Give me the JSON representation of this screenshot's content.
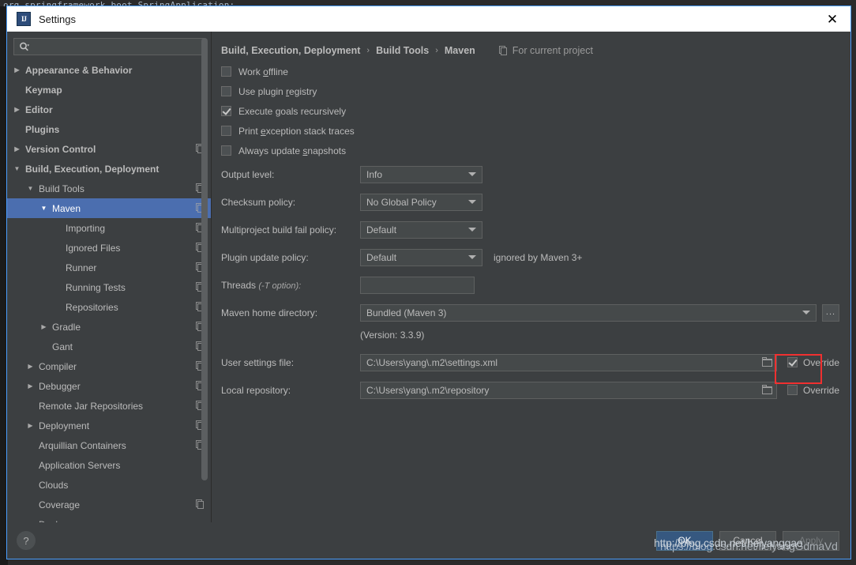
{
  "backdrop": {
    "code_line": "org.springframework.boot.SpringApplication;"
  },
  "window": {
    "title": "Settings",
    "app_icon": "IJ",
    "close_icon": "✕"
  },
  "search": {
    "value": "",
    "placeholder": "",
    "icon": "search-icon"
  },
  "sidebar": {
    "items": [
      {
        "label": "Appearance & Behavior",
        "arrow": "▶",
        "indent": 0,
        "bold": true,
        "project_icon": false,
        "selected": false
      },
      {
        "label": "Keymap",
        "arrow": "",
        "indent": 0,
        "bold": true,
        "project_icon": false,
        "selected": false
      },
      {
        "label": "Editor",
        "arrow": "▶",
        "indent": 0,
        "bold": true,
        "project_icon": false,
        "selected": false
      },
      {
        "label": "Plugins",
        "arrow": "",
        "indent": 0,
        "bold": true,
        "project_icon": false,
        "selected": false
      },
      {
        "label": "Version Control",
        "arrow": "▶",
        "indent": 0,
        "bold": true,
        "project_icon": true,
        "selected": false
      },
      {
        "label": "Build, Execution, Deployment",
        "arrow": "▼",
        "indent": 0,
        "bold": true,
        "project_icon": false,
        "selected": false
      },
      {
        "label": "Build Tools",
        "arrow": "▼",
        "indent": 1,
        "bold": false,
        "project_icon": true,
        "selected": false
      },
      {
        "label": "Maven",
        "arrow": "▼",
        "indent": 2,
        "bold": false,
        "project_icon": true,
        "selected": true
      },
      {
        "label": "Importing",
        "arrow": "",
        "indent": 3,
        "bold": false,
        "project_icon": true,
        "selected": false
      },
      {
        "label": "Ignored Files",
        "arrow": "",
        "indent": 3,
        "bold": false,
        "project_icon": true,
        "selected": false
      },
      {
        "label": "Runner",
        "arrow": "",
        "indent": 3,
        "bold": false,
        "project_icon": true,
        "selected": false
      },
      {
        "label": "Running Tests",
        "arrow": "",
        "indent": 3,
        "bold": false,
        "project_icon": true,
        "selected": false
      },
      {
        "label": "Repositories",
        "arrow": "",
        "indent": 3,
        "bold": false,
        "project_icon": true,
        "selected": false
      },
      {
        "label": "Gradle",
        "arrow": "▶",
        "indent": 2,
        "bold": false,
        "project_icon": true,
        "selected": false
      },
      {
        "label": "Gant",
        "arrow": "",
        "indent": 2,
        "bold": false,
        "project_icon": true,
        "selected": false
      },
      {
        "label": "Compiler",
        "arrow": "▶",
        "indent": 1,
        "bold": false,
        "project_icon": true,
        "selected": false
      },
      {
        "label": "Debugger",
        "arrow": "▶",
        "indent": 1,
        "bold": false,
        "project_icon": true,
        "selected": false
      },
      {
        "label": "Remote Jar Repositories",
        "arrow": "",
        "indent": 1,
        "bold": false,
        "project_icon": true,
        "selected": false
      },
      {
        "label": "Deployment",
        "arrow": "▶",
        "indent": 1,
        "bold": false,
        "project_icon": true,
        "selected": false
      },
      {
        "label": "Arquillian Containers",
        "arrow": "",
        "indent": 1,
        "bold": false,
        "project_icon": true,
        "selected": false
      },
      {
        "label": "Application Servers",
        "arrow": "",
        "indent": 1,
        "bold": false,
        "project_icon": false,
        "selected": false
      },
      {
        "label": "Clouds",
        "arrow": "",
        "indent": 1,
        "bold": false,
        "project_icon": false,
        "selected": false
      },
      {
        "label": "Coverage",
        "arrow": "",
        "indent": 1,
        "bold": false,
        "project_icon": true,
        "selected": false
      },
      {
        "label": "Docker",
        "arrow": "▶",
        "indent": 1,
        "bold": false,
        "project_icon": false,
        "selected": false
      }
    ]
  },
  "breadcrumb": {
    "parts": [
      "Build, Execution, Deployment",
      "Build Tools",
      "Maven"
    ],
    "separator": "›",
    "scope_label": "For current project"
  },
  "maven": {
    "checkboxes": [
      {
        "label_pre": "Work ",
        "mnemonic": "o",
        "label_post": "ffline",
        "checked": false
      },
      {
        "label_pre": "Use plugin ",
        "mnemonic": "r",
        "label_post": "egistry",
        "checked": false
      },
      {
        "label_pre": "Execute ",
        "mnemonic": "g",
        "label_post": "oals recursively",
        "checked": true
      },
      {
        "label_pre": "Print ",
        "mnemonic": "e",
        "label_post": "xception stack traces",
        "checked": false
      },
      {
        "label_pre": "Always update ",
        "mnemonic": "s",
        "label_post": "napshots",
        "checked": false
      }
    ],
    "output_level": {
      "label": "Output level:",
      "value": "Info"
    },
    "checksum_policy": {
      "label": "Checksum policy:",
      "value": "No Global Policy"
    },
    "multiproject_policy": {
      "label": "Multiproject build fail policy:",
      "value": "Default"
    },
    "plugin_update_policy": {
      "label": "Plugin update policy:",
      "value": "Default",
      "note": "ignored by Maven 3+"
    },
    "threads": {
      "label": "Threads",
      "hint": "(-T option):",
      "value": ""
    },
    "home_directory": {
      "label": "Maven home directory:",
      "value": "Bundled (Maven 3)",
      "browse_label": "..."
    },
    "version_note": "(Version: 3.3.9)",
    "user_settings": {
      "label": "User settings file:",
      "value": "C:\\Users\\yang\\.m2\\settings.xml",
      "override_label": "Override",
      "override_checked": true
    },
    "local_repository": {
      "label": "Local repository:",
      "value": "C:\\Users\\yang\\.m2\\repository",
      "override_label": "Override",
      "override_checked": false
    },
    "highlight_color": "#f03030"
  },
  "footer": {
    "help_label": "?",
    "ok_label": "OK",
    "cancel_label": "Cancel",
    "apply_label": "Apply"
  },
  "watermark": {
    "line_a": "http://blog.csdn.net/heiyanggao",
    "line_b": "https://blog.csdn.net/lielyangGdmaVd"
  }
}
